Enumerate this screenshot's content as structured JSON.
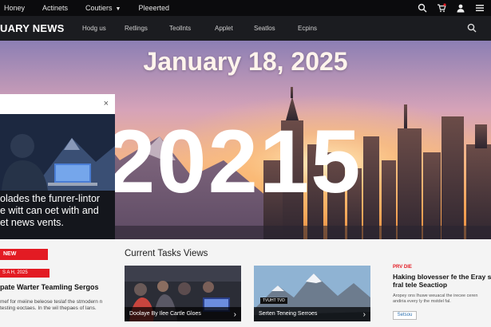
{
  "topbar": {
    "links": [
      "Honey",
      "Actinets",
      "Coutiers",
      "Pleeerted"
    ],
    "dropdown_chevron": "chevron-down-icon",
    "icons": [
      "search-icon",
      "cart-icon",
      "user-icon",
      "menu-icon"
    ]
  },
  "navbar": {
    "logo": "UARY NEWS",
    "links": [
      "Hodg us",
      "Retlings",
      "Teollnts",
      "Applet",
      "Seatlos",
      "Ecpins"
    ],
    "search_icon": "search-icon"
  },
  "hero": {
    "date": "January 18, 2025",
    "year": "20215"
  },
  "panel": {
    "close": "×",
    "text_lines": [
      "olades the funrer-lintor",
      "e witt can oet with and",
      "et news vents."
    ]
  },
  "left_column": {
    "tag": "NEW",
    "tag2": "S A H, 2025",
    "title": "pate Warter Teamling Sergos",
    "desc": "mef for meiine beleose teslaf the stmodern n testing eoctaes. In the wil thepaes of lans."
  },
  "section": {
    "title": "Current Tasks Views"
  },
  "cards": [
    {
      "caption": "Doolaye By Ilee Cartle Gloes",
      "arrow": "›"
    },
    {
      "caption": "Serten Teneing Serroes",
      "badge": "TVUHT TVD",
      "arrow": "›"
    }
  ],
  "right_story": {
    "tag": "PRV DIE",
    "title_lines": [
      "Haking blovesser fe the Eray stera",
      "fral tele Seactiop"
    ],
    "desc_lines": [
      "Aropey ons lhuwe weuacal the irecee ceren",
      "andiria every ly the mstdel fal."
    ],
    "button": "Setsou"
  },
  "colors": {
    "accent_red": "#e31b23",
    "topbar_bg": "#0b0b0d",
    "navbar_bg": "#1b1c20",
    "panel_bg": "#14161c"
  }
}
